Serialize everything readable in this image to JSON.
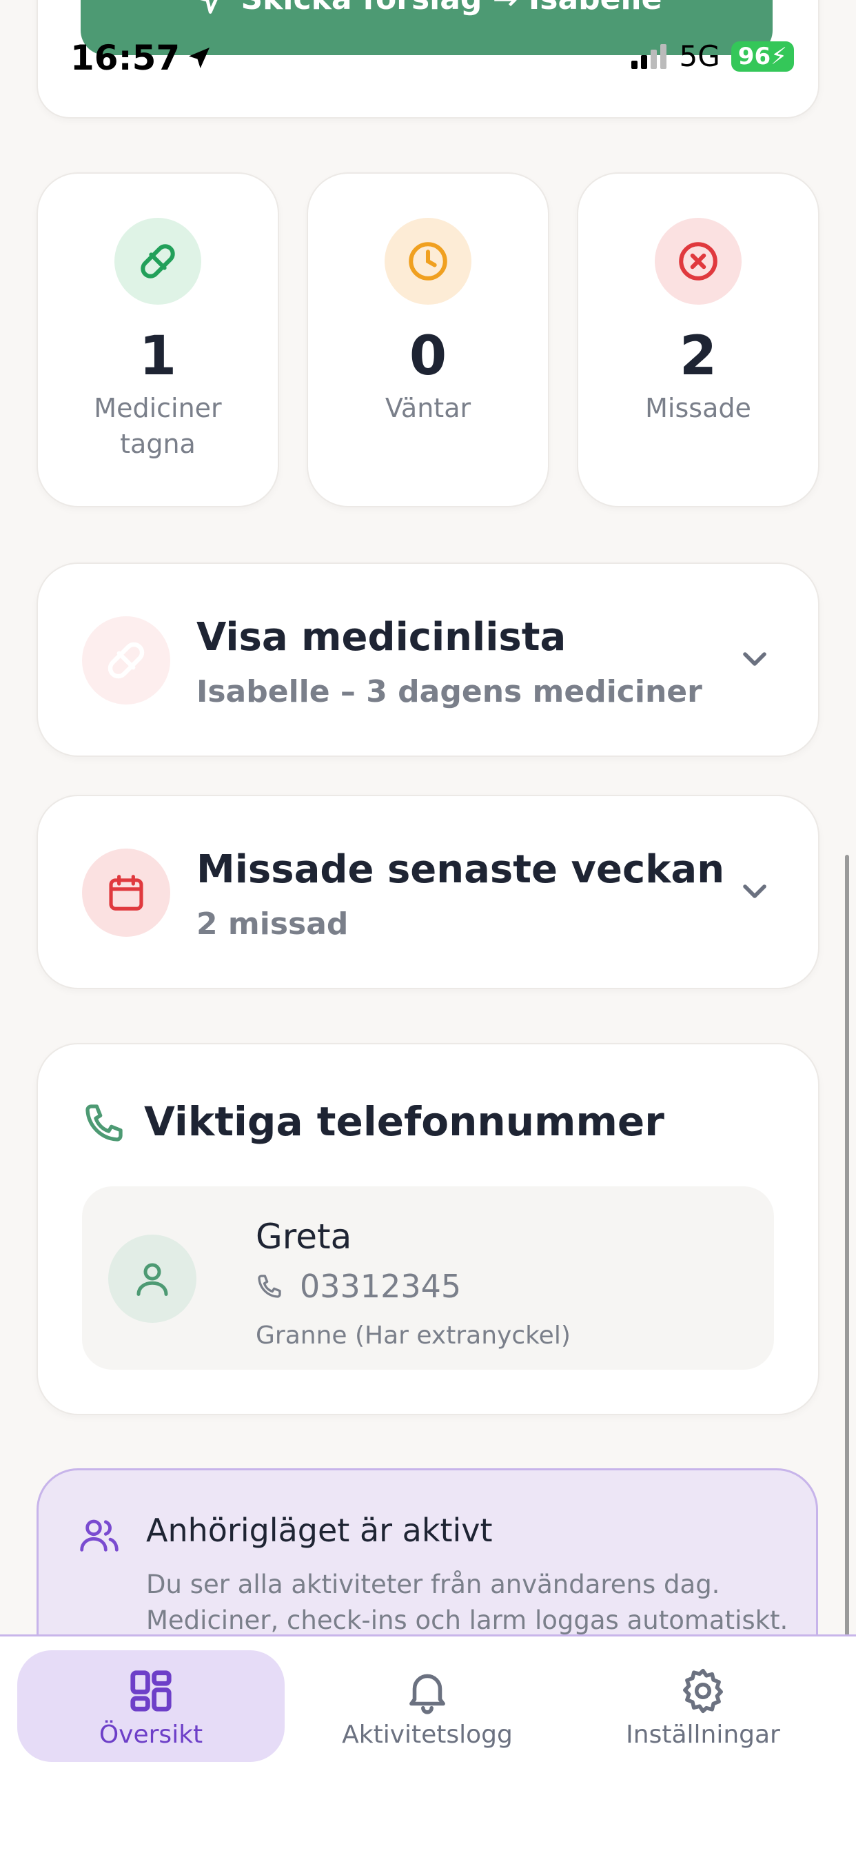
{
  "status_bar": {
    "time": "16:57",
    "network": "5G",
    "battery": "96"
  },
  "top": {
    "send_label": "Skicka förslag → Isabelle"
  },
  "stats": [
    {
      "value": "1",
      "label": "Mediciner tagna",
      "color": "#22a05a",
      "bg": "#dff3e6",
      "icon": "pill-icon"
    },
    {
      "value": "0",
      "label": "Väntar",
      "color": "#f0a020",
      "bg": "#fdecd6",
      "icon": "clock-icon"
    },
    {
      "value": "2",
      "label": "Missade",
      "color": "#e0393e",
      "bg": "#fbe1e1",
      "icon": "x-circle-icon"
    }
  ],
  "medicine_list": {
    "title": "Visa medicinlista",
    "subtitle": "Isabelle – 3 dagens mediciner"
  },
  "missed_week": {
    "title": "Missade senaste veckan",
    "subtitle": "2 missad"
  },
  "phones": {
    "title": "Viktiga telefonnummer",
    "contacts": [
      {
        "name": "Greta",
        "phone": "03312345",
        "note": "Granne (Har extranyckel)"
      }
    ]
  },
  "banner": {
    "title": "Anhörigläget är aktivt",
    "text": "Du ser alla aktiviteter från användarens dag. Mediciner, check-ins och larm loggas automatiskt."
  },
  "nav": {
    "items": [
      {
        "label": "Översikt",
        "active": true
      },
      {
        "label": "Aktivitetslogg",
        "active": false
      },
      {
        "label": "Inställningar",
        "active": false
      }
    ]
  },
  "colors": {
    "accent": "#6d3fc8",
    "green": "#4d9a73",
    "red": "#e0393e"
  }
}
